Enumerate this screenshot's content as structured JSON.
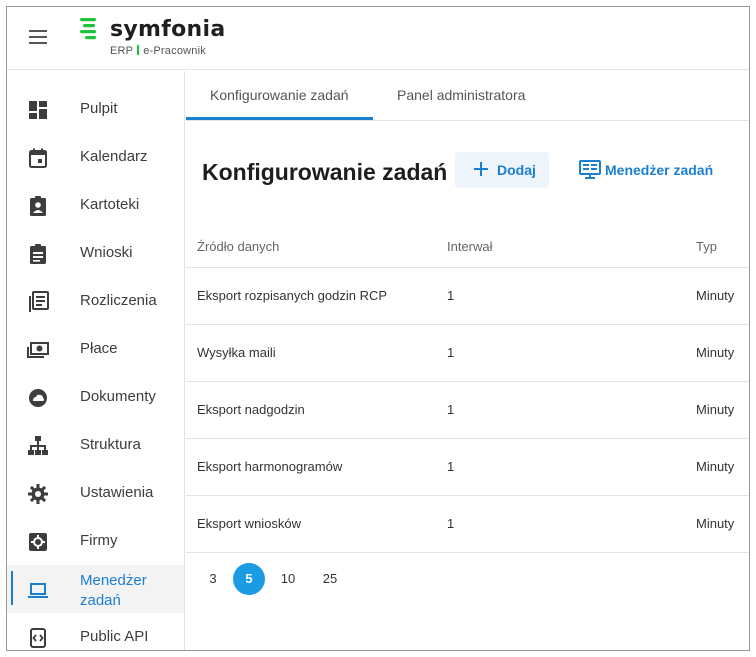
{
  "brand": {
    "name": "symfonia",
    "sub_left": "ERP",
    "sub_right": "e-Pracownik",
    "accent": "#1dc53b"
  },
  "sidebar": {
    "items": [
      {
        "label": "Pulpit",
        "icon": "dashboard-icon"
      },
      {
        "label": "Kalendarz",
        "icon": "calendar-icon"
      },
      {
        "label": "Kartoteki",
        "icon": "id-badge-icon"
      },
      {
        "label": "Wnioski",
        "icon": "clipboard-icon"
      },
      {
        "label": "Rozliczenia",
        "icon": "ledger-icon"
      },
      {
        "label": "Płace",
        "icon": "money-icon"
      },
      {
        "label": "Dokumenty",
        "icon": "cloud-icon"
      },
      {
        "label": "Struktura",
        "icon": "org-chart-icon"
      },
      {
        "label": "Ustawienia",
        "icon": "gear-icon"
      },
      {
        "label": "Firmy",
        "icon": "company-icon"
      },
      {
        "label": "Menedżer zadań",
        "icon": "laptop-icon",
        "active": true
      },
      {
        "label": "Public API",
        "icon": "code-icon"
      }
    ]
  },
  "tabs": [
    {
      "label": "Konfigurowanie zadań",
      "active": true
    },
    {
      "label": "Panel administratora",
      "active": false
    }
  ],
  "page": {
    "title": "Konfigurowanie zadań",
    "add_label": "Dodaj",
    "manager_label": "Menedżer zadań"
  },
  "table": {
    "headers": [
      "Źródło danych",
      "Interwał",
      "Typ"
    ],
    "rows": [
      [
        "Eksport rozpisanych godzin RCP",
        "1",
        "Minuty"
      ],
      [
        "Wysyłka maili",
        "1",
        "Minuty"
      ],
      [
        "Eksport nadgodzin",
        "1",
        "Minuty"
      ],
      [
        "Eksport harmonogramów",
        "1",
        "Minuty"
      ],
      [
        "Eksport wniosków",
        "1",
        "Minuty"
      ]
    ]
  },
  "pagination": {
    "options": [
      "3",
      "5",
      "10",
      "25"
    ],
    "selected": "5"
  },
  "colors": {
    "primary": "#1b7fd1",
    "page_size_active": "#1b9be3"
  }
}
